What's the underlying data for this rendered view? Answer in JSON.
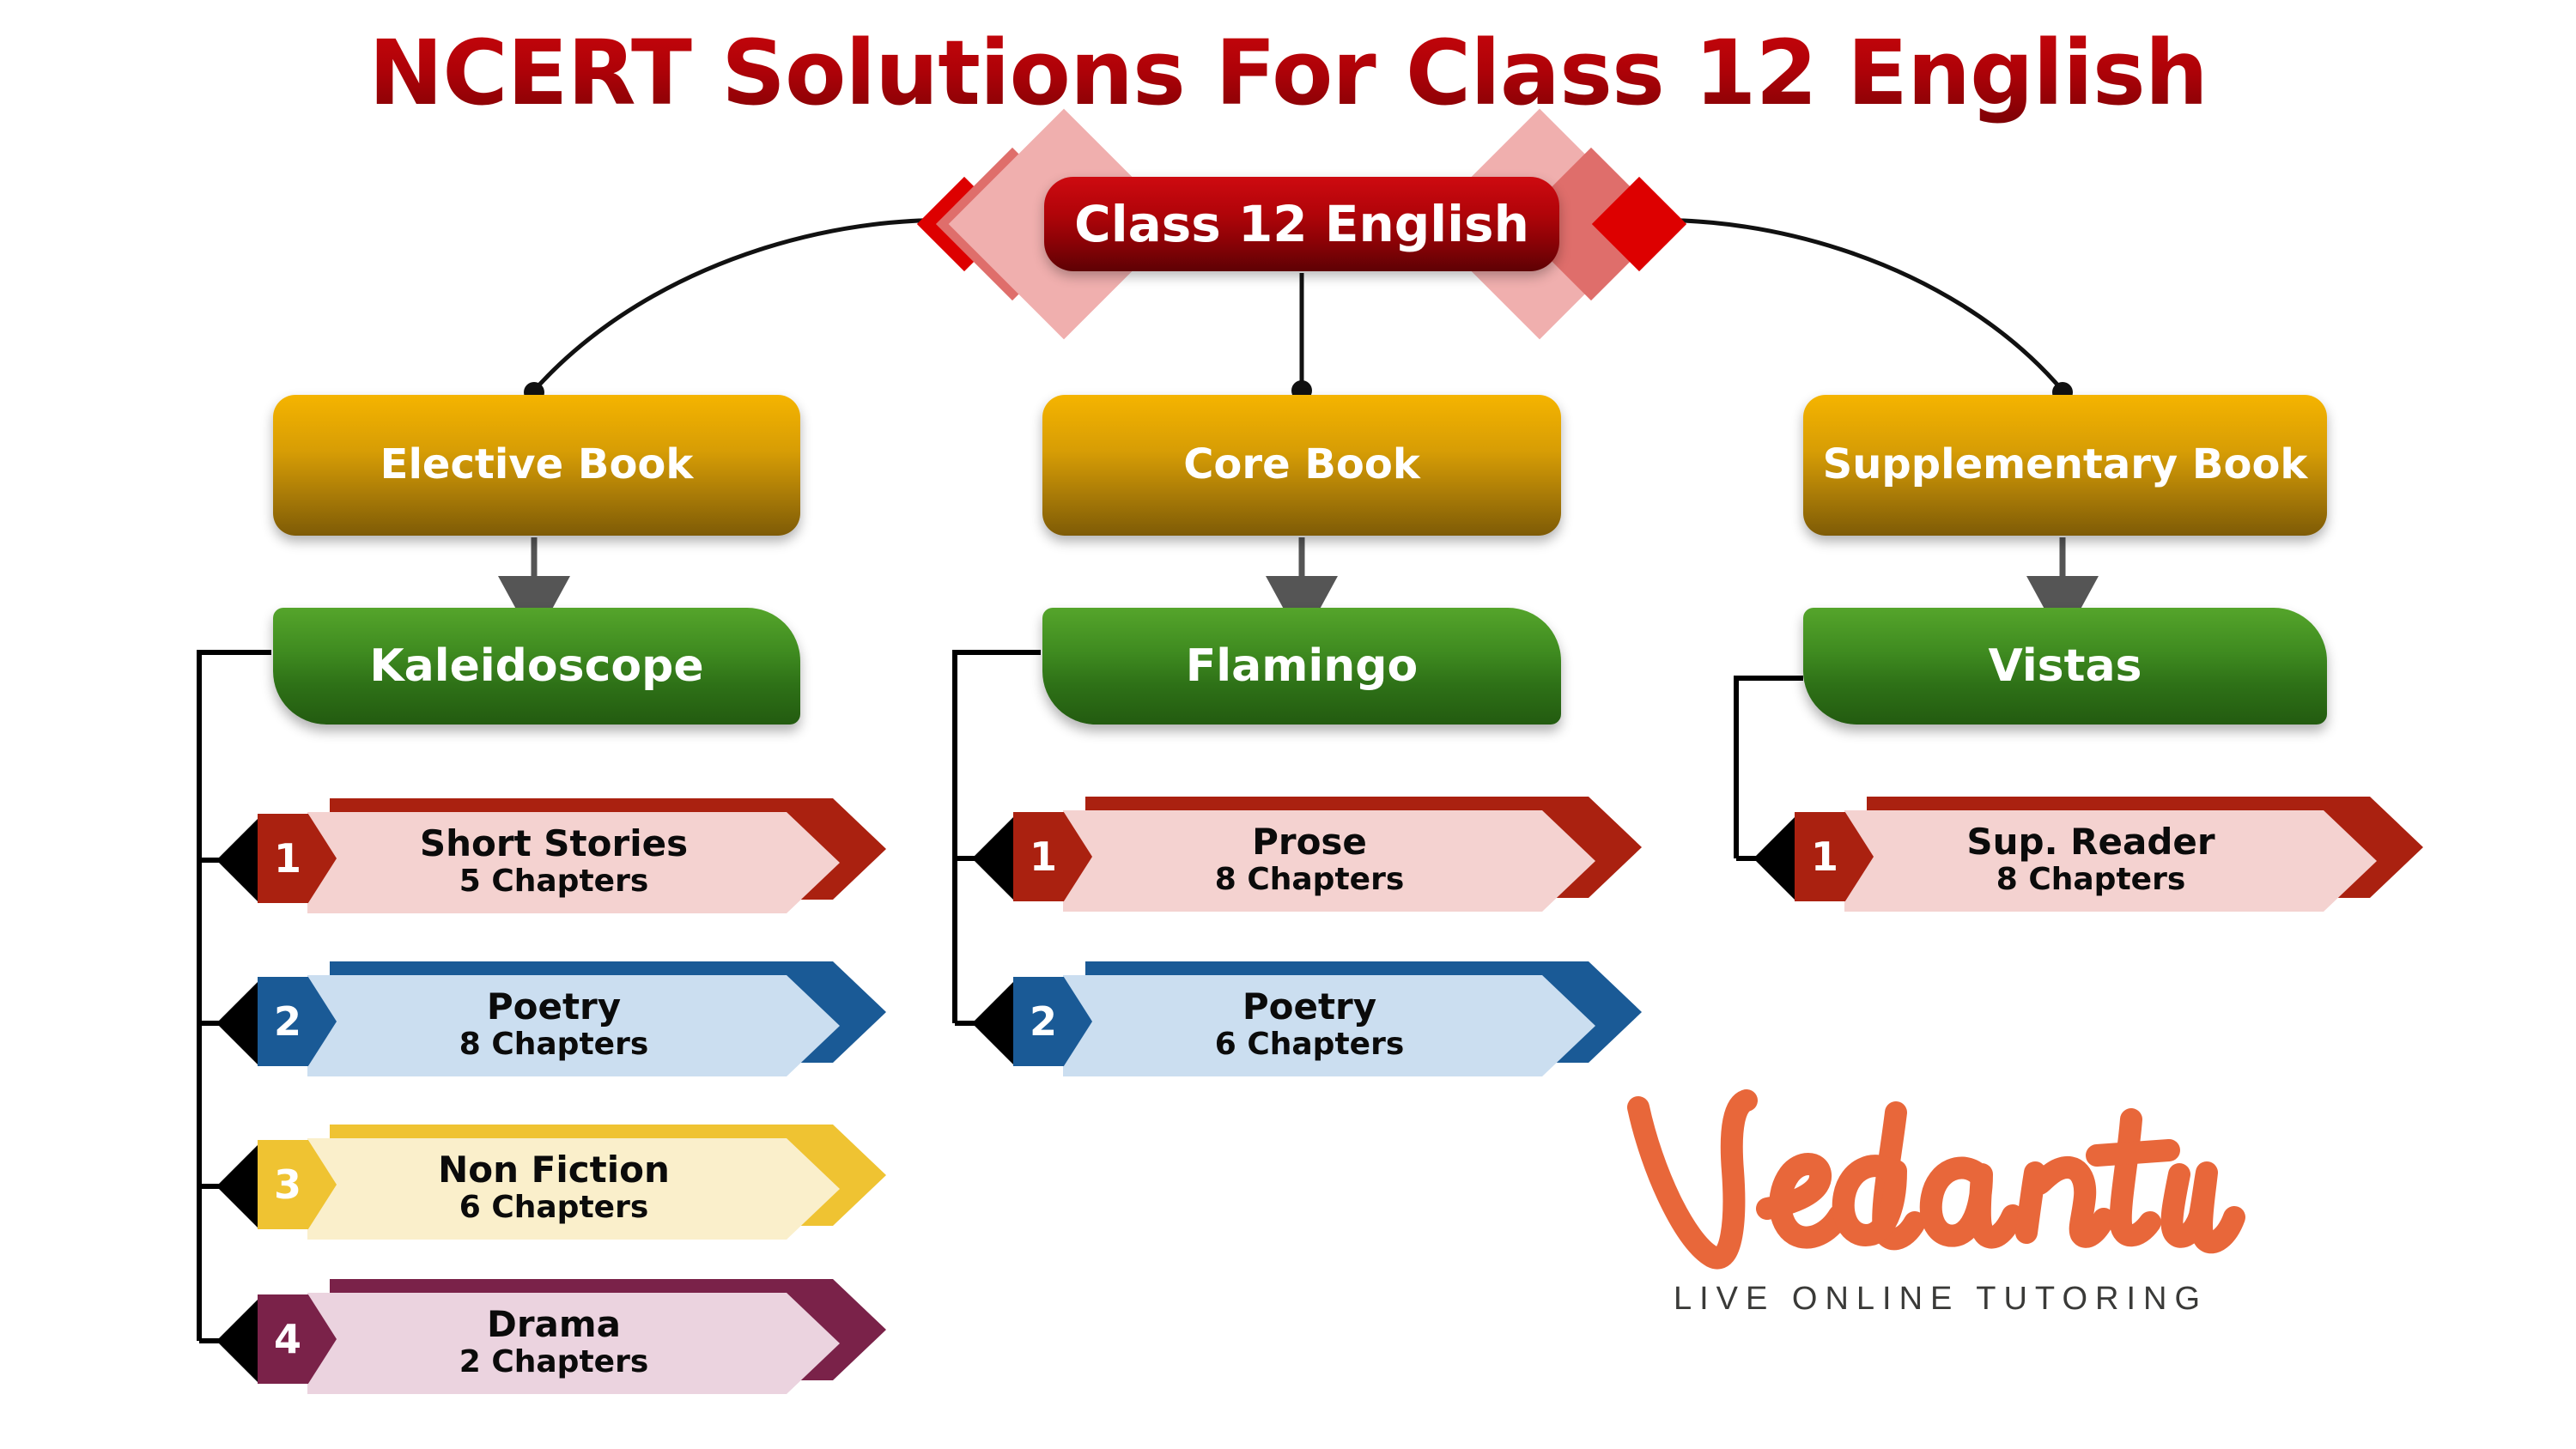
{
  "page": {
    "title": "NCERT Solutions For Class 12 English",
    "title_color": "#B00409",
    "background": "#FFFFFF"
  },
  "root": {
    "label": "Class 12 English",
    "color": "#B00409",
    "diamond_colors": [
      "#F0AFAE",
      "#DF6E6B",
      "#DD0000"
    ]
  },
  "columns": [
    {
      "book_type": {
        "label": "Elective Book",
        "color": "#D79D05"
      },
      "book_name": {
        "label": "Kaleidoscope",
        "color": "#3F8B20"
      },
      "sections": [
        {
          "number": "1",
          "title": "Short Stories",
          "chapters": "5 Chapters",
          "badge_color": "#AA2110",
          "body_color": "#F4D2D0"
        },
        {
          "number": "2",
          "title": "Poetry",
          "chapters": "8 Chapters",
          "badge_color": "#1A5A96",
          "body_color": "#CBDEF0"
        },
        {
          "number": "3",
          "title": "Non Fiction",
          "chapters": "6 Chapters",
          "badge_color": "#EFC332",
          "body_color": "#FAEFCB"
        },
        {
          "number": "4",
          "title": "Drama",
          "chapters": "2 Chapters",
          "badge_color": "#7A2249",
          "body_color": "#EBD3DF"
        }
      ]
    },
    {
      "book_type": {
        "label": "Core Book",
        "color": "#D79D05"
      },
      "book_name": {
        "label": "Flamingo",
        "color": "#3F8B20"
      },
      "sections": [
        {
          "number": "1",
          "title": "Prose",
          "chapters": "8 Chapters",
          "badge_color": "#AA2110",
          "body_color": "#F4D2D0"
        },
        {
          "number": "2",
          "title": "Poetry",
          "chapters": "6 Chapters",
          "badge_color": "#1A5A96",
          "body_color": "#CBDEF0"
        }
      ]
    },
    {
      "book_type": {
        "label": "Supplementary Book",
        "color": "#D79D05"
      },
      "book_name": {
        "label": "Vistas",
        "color": "#3F8B20"
      },
      "sections": [
        {
          "number": "1",
          "title": "Sup. Reader",
          "chapters": "8 Chapters",
          "badge_color": "#AA2110",
          "body_color": "#F4D2D0"
        }
      ]
    }
  ],
  "logo": {
    "wordmark": "Vedantu",
    "tagline": "LIVE ONLINE TUTORING",
    "color": "#E8673A",
    "tagline_color": "#3A3A38"
  }
}
